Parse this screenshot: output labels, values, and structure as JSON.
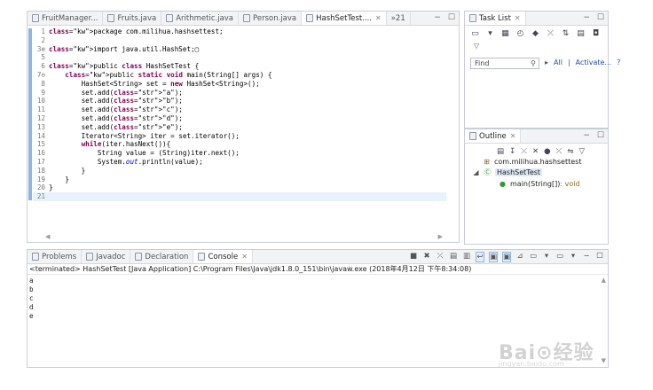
{
  "editor": {
    "tabs": [
      {
        "label": "FruitManager..."
      },
      {
        "label": "Fruits.java"
      },
      {
        "label": "Arithmetic.java"
      },
      {
        "label": "Person.java"
      },
      {
        "label": "HashSetTest...."
      },
      {
        "label": "»21"
      }
    ],
    "code": [
      {
        "n": "1",
        "t": "package com.milihua.hashsettest;"
      },
      {
        "n": "2",
        "t": ""
      },
      {
        "n": "3⊕",
        "t": "import java.util.HashSet;▢"
      },
      {
        "n": "5",
        "t": ""
      },
      {
        "n": "6",
        "t": "public class HashSetTest {"
      },
      {
        "n": "7⊖",
        "t": "    public static void main(String[] args) {"
      },
      {
        "n": "8",
        "t": "        HashSet<String> set = new HashSet<String>();"
      },
      {
        "n": "9",
        "t": "        set.add(\"a\");"
      },
      {
        "n": "10",
        "t": "        set.add(\"b\");"
      },
      {
        "n": "11",
        "t": "        set.add(\"c\");"
      },
      {
        "n": "12",
        "t": "        set.add(\"d\");"
      },
      {
        "n": "13",
        "t": "        set.add(\"e\");"
      },
      {
        "n": "14",
        "t": "        Iterator<String> iter = set.iterator();"
      },
      {
        "n": "15",
        "t": "        while(iter.hasNext()){"
      },
      {
        "n": "16",
        "t": "            String value = (String)iter.next();"
      },
      {
        "n": "17",
        "t": "            System.out.println(value);"
      },
      {
        "n": "18",
        "t": "        }"
      },
      {
        "n": "19",
        "t": "    }"
      },
      {
        "n": "20",
        "t": "}"
      },
      {
        "n": "21",
        "t": ""
      }
    ]
  },
  "tasklist": {
    "title": "Task List",
    "find_placeholder": "Find",
    "all_label": "All",
    "activate_label": "Activate...",
    "help_label": "?"
  },
  "outline": {
    "title": "Outline",
    "package": "com.milihua.hashsettest",
    "class": "HashSetTest",
    "method": "main(String[])",
    "method_ret": " : void"
  },
  "console": {
    "tabs": [
      "Problems",
      "Javadoc",
      "Declaration",
      "Console"
    ],
    "terminated": "<terminated> HashSetTest [Java Application] C:\\Program Files\\Java\\jdk1.8.0_151\\bin\\javaw.exe (2018年4月12日 下午8:34:08)",
    "output": [
      "a",
      "b",
      "c",
      "d",
      "e"
    ]
  },
  "watermark": {
    "text": "Bai⊙经验",
    "sub": "jingyan.baidu.com"
  },
  "colors": {
    "keyword": "#7f0055",
    "string": "#2a00ff",
    "field": "#0000c0",
    "accent": "#8fb5e0"
  }
}
